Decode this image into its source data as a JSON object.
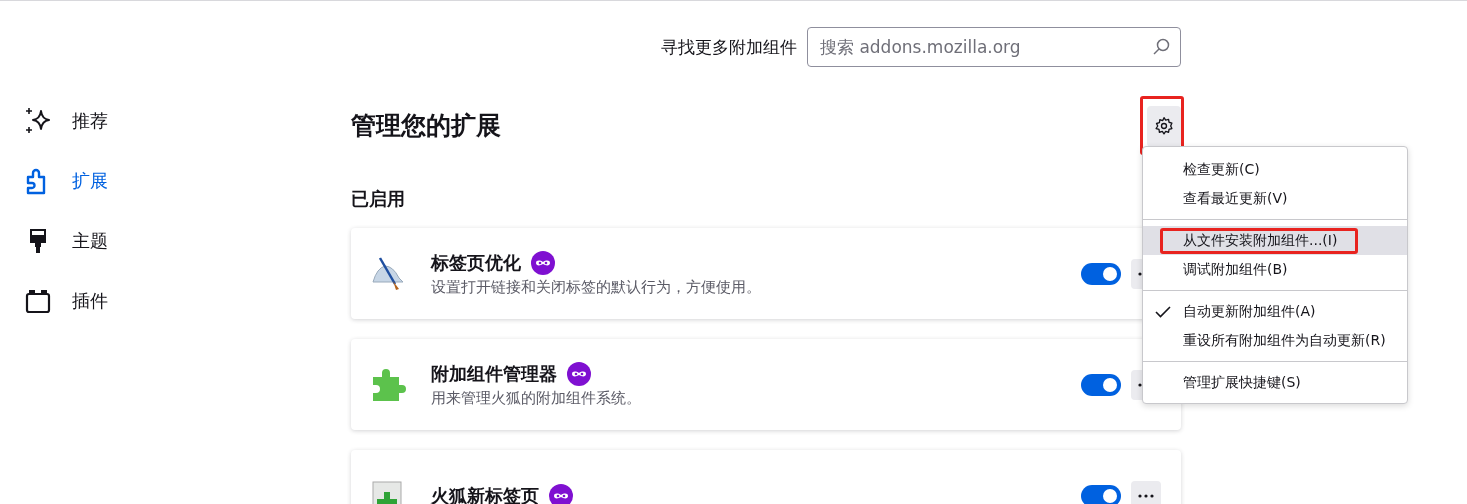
{
  "search": {
    "label": "寻找更多附加组件",
    "placeholder": "搜索 addons.mozilla.org"
  },
  "sidebar": {
    "items": [
      {
        "label": "推荐",
        "selected": false,
        "kind": "sparkle"
      },
      {
        "label": "扩展",
        "selected": true,
        "kind": "puzzle"
      },
      {
        "label": "主题",
        "selected": false,
        "kind": "brush"
      },
      {
        "label": "插件",
        "selected": false,
        "kind": "plugin"
      }
    ]
  },
  "heading": "管理您的扩展",
  "settings_button": {
    "highlighted": true
  },
  "sections": [
    {
      "title": "已启用",
      "extensions": [
        {
          "name": "标签页优化",
          "description": "设置打开链接和关闭标签的默认行为，方便使用。",
          "enabled": true,
          "kind": "brush"
        },
        {
          "name": "附加组件管理器",
          "description": "用来管理火狐的附加组件系统。",
          "enabled": true,
          "kind": "puzzle"
        },
        {
          "name": "火狐新标签页",
          "enabled": true,
          "kind": "newtab"
        }
      ]
    }
  ],
  "menu": {
    "items": [
      {
        "kind": "item",
        "label": "检查更新(C)",
        "checked": false,
        "hovered": false,
        "highlighted": false
      },
      {
        "kind": "item",
        "label": "查看最近更新(V)",
        "checked": false,
        "hovered": false,
        "highlighted": false
      },
      {
        "kind": "separator"
      },
      {
        "kind": "item",
        "label": "从文件安装附加组件...(I)",
        "checked": false,
        "hovered": true,
        "highlighted": true
      },
      {
        "kind": "item",
        "label": "调试附加组件(B)",
        "checked": false,
        "hovered": false,
        "highlighted": false
      },
      {
        "kind": "separator"
      },
      {
        "kind": "item",
        "label": "自动更新附加组件(A)",
        "checked": true,
        "hovered": false,
        "highlighted": false
      },
      {
        "kind": "item",
        "label": "重设所有附加组件为自动更新(R)",
        "checked": false,
        "hovered": false,
        "highlighted": false
      },
      {
        "kind": "separator"
      },
      {
        "kind": "item",
        "label": "管理扩展快捷键(S)",
        "checked": false,
        "hovered": false,
        "highlighted": false
      }
    ]
  }
}
